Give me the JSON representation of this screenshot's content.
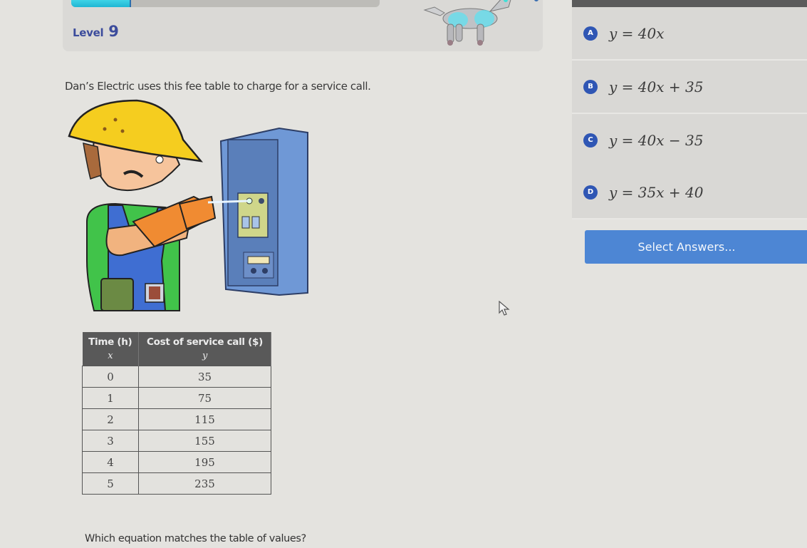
{
  "header": {
    "level_label": "Level",
    "level_number": "9",
    "progress_fraction": 0.19
  },
  "problem": {
    "intro": "Dan’s Electric uses this fee table to charge for a service call.",
    "table": {
      "columns": [
        {
          "title": "Time (h)",
          "variable": "x"
        },
        {
          "title": "Cost of service call ($)",
          "variable": "y"
        }
      ],
      "rows": [
        [
          "0",
          "35"
        ],
        [
          "1",
          "75"
        ],
        [
          "2",
          "115"
        ],
        [
          "3",
          "155"
        ],
        [
          "4",
          "195"
        ],
        [
          "5",
          "235"
        ]
      ]
    },
    "question": "Which equation matches the table of values?"
  },
  "answers": [
    {
      "letter": "A",
      "equation": "y = 40x"
    },
    {
      "letter": "B",
      "equation": "y = 40x + 35"
    },
    {
      "letter": "C",
      "equation": "y = 40x − 35"
    },
    {
      "letter": "D",
      "equation": "y = 35x + 40"
    }
  ],
  "select_button": {
    "label": "Select Answers..."
  },
  "colors": {
    "accent": "#4d86d4",
    "badge": "#2f56b4",
    "level_text": "#3c4c9c",
    "progress": "#1fb6d4"
  },
  "icons": {
    "mascot": "robot-dog-icon",
    "illustration": "electrician-illustration",
    "cursor": "mouse-pointer-icon"
  }
}
